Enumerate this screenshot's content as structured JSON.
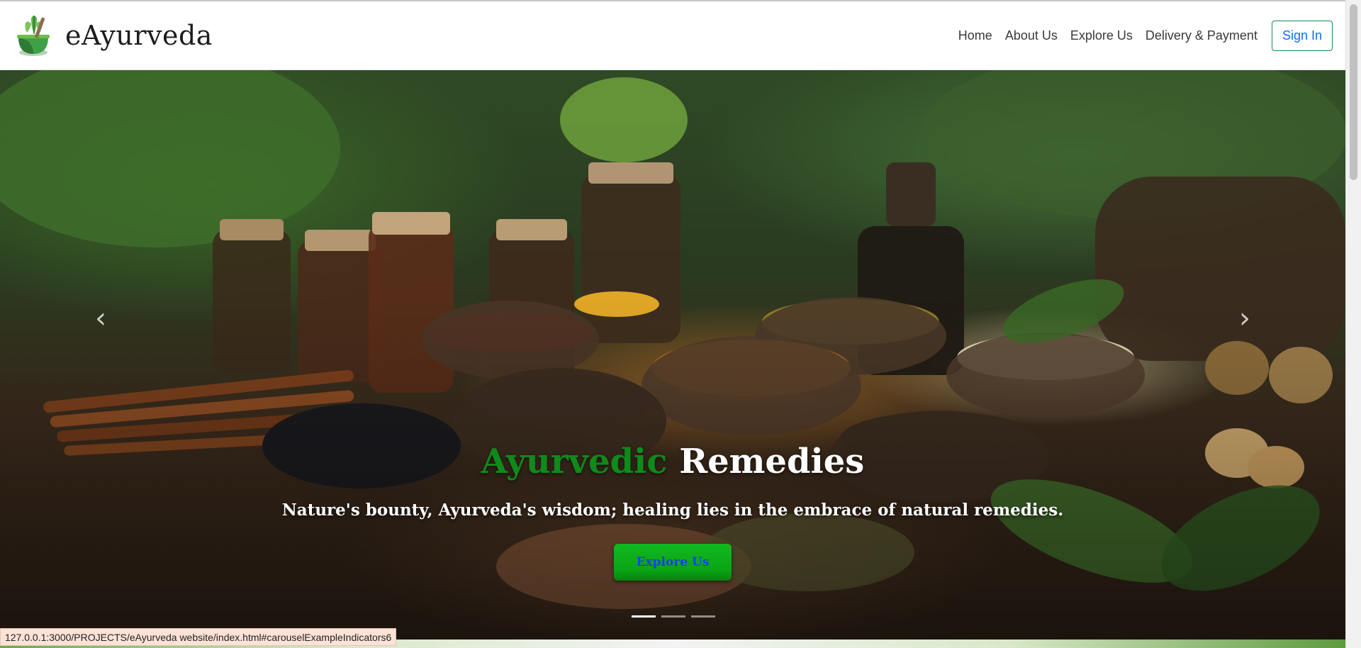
{
  "brand": {
    "name": "eAyurveda"
  },
  "nav": {
    "links": [
      "Home",
      "About Us",
      "Explore Us",
      "Delivery & Payment"
    ],
    "signin_label": "Sign In"
  },
  "carousel": {
    "prev_icon": "chevron-left-icon",
    "next_icon": "chevron-right-icon",
    "caption": {
      "title_accent": "Ayurvedic",
      "title_rest": " Remedies",
      "subtitle": "Nature's bounty, Ayurveda's wisdom; healing lies in the embrace of natural remedies.",
      "button_label": "Explore Us"
    },
    "indicators": 3,
    "active_index": 0
  },
  "status_bar": {
    "url": "127.0.0.1:3000/PROJECTS/eAyurveda website/index.html#carouselExampleIndicators6"
  },
  "colors": {
    "accent_green": "#0f8a1b",
    "button_green": "#0aa615",
    "link_blue": "#0d6efd"
  }
}
